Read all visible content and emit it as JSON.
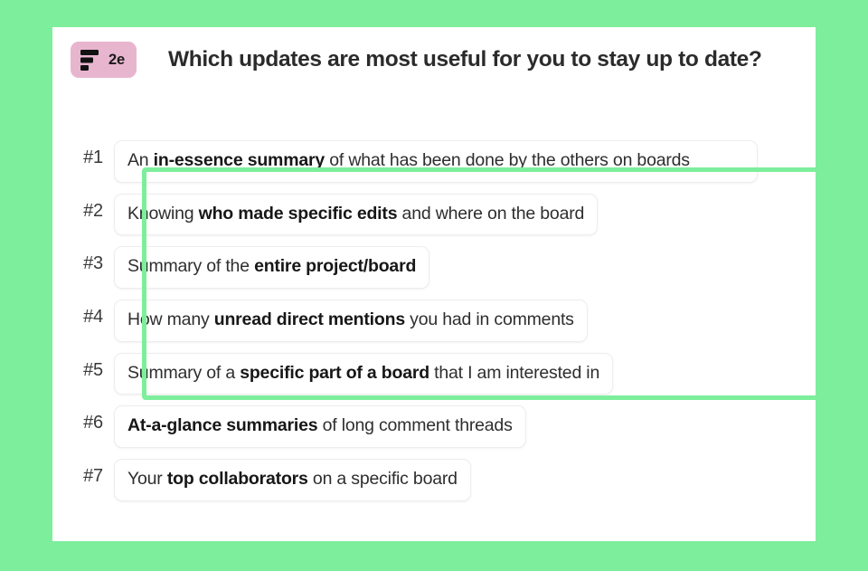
{
  "colors": {
    "background_green": "#7dee9c",
    "card_white": "#ffffff",
    "badge_pink": "#e8b5cf",
    "highlight_green": "#7dee9c",
    "text_dark": "#2b2b2b",
    "box_border": "#ededed"
  },
  "header": {
    "badge_label": "2e",
    "logo_icon": "figma-bars-icon",
    "title": "Which updates are most useful for you to stay up to date?"
  },
  "ranking": {
    "items": [
      {
        "rank": "#1",
        "parts": [
          {
            "text": "An ",
            "bold": false
          },
          {
            "text": "in-essence summary",
            "bold": true
          },
          {
            "text": " of what has been done by the others on boards",
            "bold": false
          }
        ],
        "highlighted": true,
        "wide": true
      },
      {
        "rank": "#2",
        "parts": [
          {
            "text": "Knowing ",
            "bold": false
          },
          {
            "text": "who made specific edits",
            "bold": true
          },
          {
            "text": " and where on the board",
            "bold": false
          }
        ],
        "highlighted": true,
        "wide": false
      },
      {
        "rank": "#3",
        "parts": [
          {
            "text": "Summary of the ",
            "bold": false
          },
          {
            "text": "entire project/board",
            "bold": true
          }
        ],
        "highlighted": true,
        "wide": false
      },
      {
        "rank": "#4",
        "parts": [
          {
            "text": "How many ",
            "bold": false
          },
          {
            "text": "unread direct mentions",
            "bold": true
          },
          {
            "text": " you had in comments",
            "bold": false
          }
        ],
        "highlighted": true,
        "wide": false
      },
      {
        "rank": "#5",
        "parts": [
          {
            "text": "Summary of a ",
            "bold": false
          },
          {
            "text": "specific part of a board",
            "bold": true
          },
          {
            "text": " that I am interested in",
            "bold": false
          }
        ],
        "highlighted": false,
        "wide": false
      },
      {
        "rank": "#6",
        "parts": [
          {
            "text": "At-a-glance summaries",
            "bold": true
          },
          {
            "text": " of long comment threads",
            "bold": false
          }
        ],
        "highlighted": false,
        "wide": false
      },
      {
        "rank": "#7",
        "parts": [
          {
            "text": "Your ",
            "bold": false
          },
          {
            "text": "top collaborators",
            "bold": true
          },
          {
            "text": " on a specific board",
            "bold": false
          }
        ],
        "highlighted": false,
        "wide": false
      }
    ]
  },
  "highlight_frame": {
    "covers_ranks": [
      "#1",
      "#2",
      "#3",
      "#4"
    ]
  }
}
